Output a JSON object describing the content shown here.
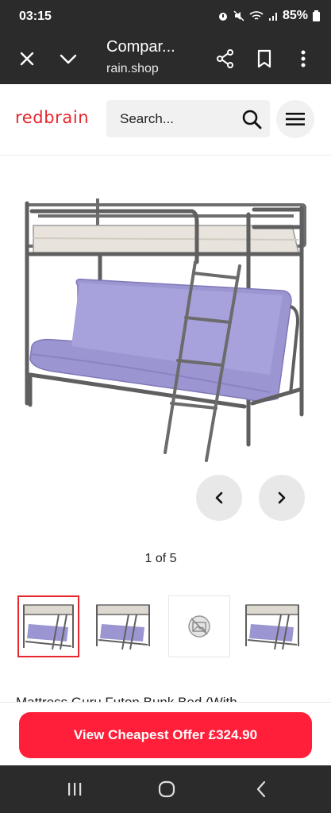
{
  "status_bar": {
    "time": "03:15",
    "battery": "85%",
    "icons": [
      "alarm-icon",
      "mute-icon",
      "wifi-icon",
      "signal-icon",
      "battery-icon"
    ]
  },
  "browser": {
    "title": "Compar...",
    "url": "​rain.shop",
    "close_icon": "close-icon",
    "collapse_icon": "chevron-down-icon",
    "share_icon": "share-icon",
    "bookmark_icon": "bookmark-icon",
    "more_icon": "more-vertical-icon"
  },
  "header": {
    "logo": "redbrain",
    "search_placeholder": "Search...",
    "menu_icon": "hamburger-icon"
  },
  "gallery": {
    "counter": "1 of 5",
    "prev_icon": "chevron-left-icon",
    "next_icon": "chevron-right-icon",
    "thumbnails": [
      {
        "kind": "bunk-bed",
        "active": true
      },
      {
        "kind": "bunk-bed",
        "active": false
      },
      {
        "kind": "placeholder",
        "active": false
      },
      {
        "kind": "bunk-bed",
        "active": false
      }
    ]
  },
  "product": {
    "name": "Mattress Guru Futon Bunk Bed (With"
  },
  "cta": {
    "label": "View Cheapest Offer £324.90"
  },
  "colors": {
    "brand": "#e8262d",
    "cta": "#ff1f3a",
    "bar": "#2b2b2b"
  }
}
